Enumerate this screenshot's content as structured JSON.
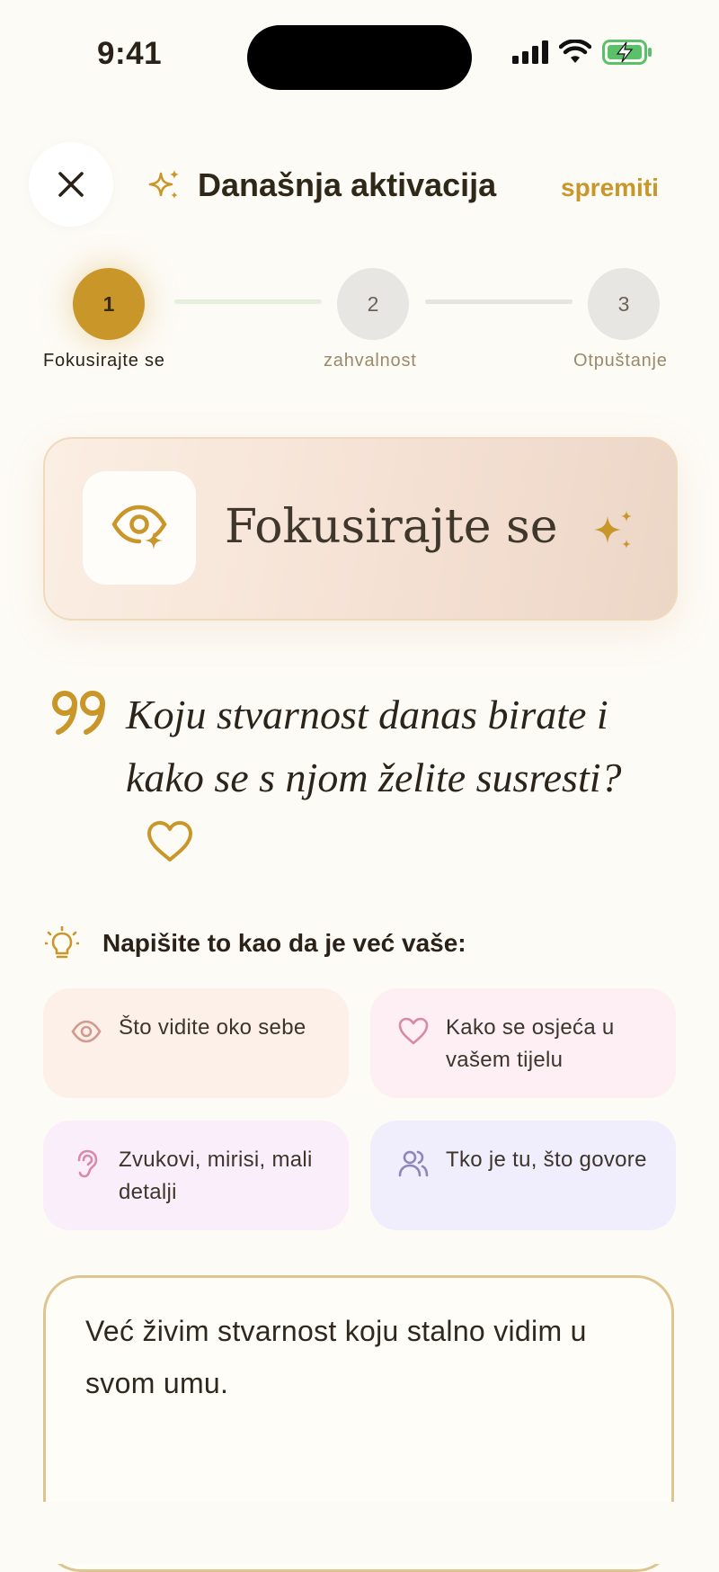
{
  "status_bar": {
    "time": "9:41"
  },
  "header": {
    "title": "Današnja aktivacija",
    "save_label": "spremiti"
  },
  "stepper": {
    "steps": [
      {
        "number": "1",
        "label": "Fokusirajte se",
        "active": true
      },
      {
        "number": "2",
        "label": "zahvalnost",
        "active": false
      },
      {
        "number": "3",
        "label": "Otpuštanje",
        "active": false
      }
    ]
  },
  "focus_card": {
    "title": "Fokusirajte se",
    "icon": "eye-sparkle-icon"
  },
  "prompt": {
    "question": "Koju stvarnost danas birate i kako se s njom želite susresti?"
  },
  "hint": {
    "title": "Napišite to kao da je već vaše:",
    "tips": [
      {
        "text": "Što vidite oko sebe",
        "icon": "eye-icon",
        "bg": "#fdf0e8"
      },
      {
        "text": "Kako se osjeća u vašem tijelu",
        "icon": "heart-icon",
        "bg": "#fdeff4"
      },
      {
        "text": "Zvukovi, mirisi, mali detalji",
        "icon": "ear-icon",
        "bg": "#fbeefb"
      },
      {
        "text": "Tko je tu, što govore",
        "icon": "users-icon",
        "bg": "#f0eefd"
      }
    ]
  },
  "answer": {
    "text": "Već živim stvarnost koju stalno vidim u svom umu."
  },
  "colors": {
    "accent": "#c9962a",
    "background": "#fdfbf6",
    "text": "#2a2218"
  }
}
